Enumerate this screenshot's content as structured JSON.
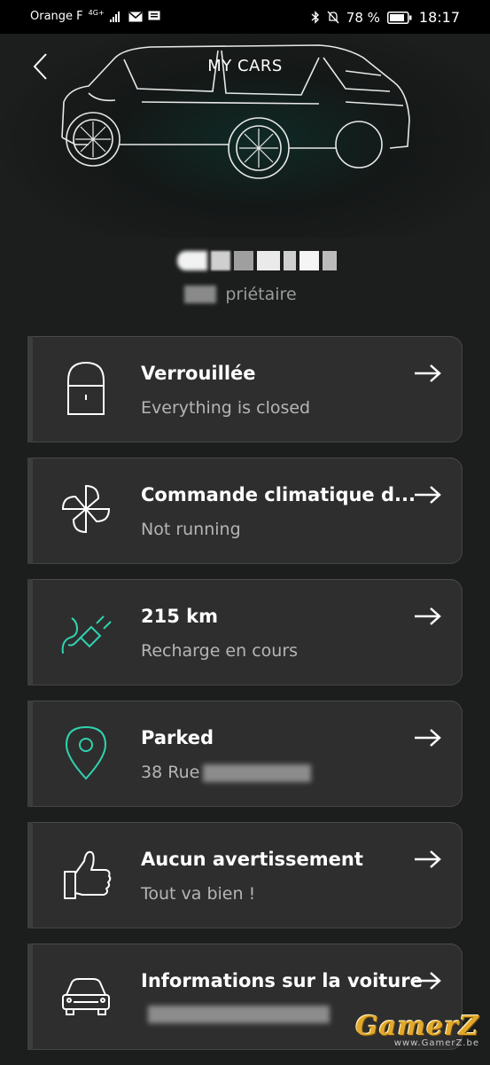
{
  "status_bar": {
    "carrier": "Orange F",
    "network": "4G+",
    "battery_percent": "78 %",
    "time": "18:17"
  },
  "header": {
    "title": "MY CARS",
    "owner_role": "priétaire"
  },
  "cards": [
    {
      "title": "Verrouillée",
      "subtitle": "Everything is closed",
      "icon": "lock-icon"
    },
    {
      "title": "Commande climatique d...",
      "subtitle": "Not running",
      "icon": "fan-icon"
    },
    {
      "title": "215 km",
      "subtitle": "Recharge en cours",
      "icon": "plug-icon"
    },
    {
      "title": "Parked",
      "subtitle": "38 Rue",
      "icon": "location-pin-icon"
    },
    {
      "title": "Aucun avertissement",
      "subtitle": "Tout va bien !",
      "icon": "thumbs-up-icon"
    },
    {
      "title": "Informations sur la voiture",
      "subtitle": "",
      "icon": "car-icon"
    }
  ],
  "watermark": {
    "logo": "GamerZ",
    "url": "www.GamerZ.be"
  },
  "colors": {
    "background": "#1c1d1d",
    "card": "#2e2e2e",
    "accent": "#2fd3b0",
    "watermark_gold": "#e2a82a"
  }
}
